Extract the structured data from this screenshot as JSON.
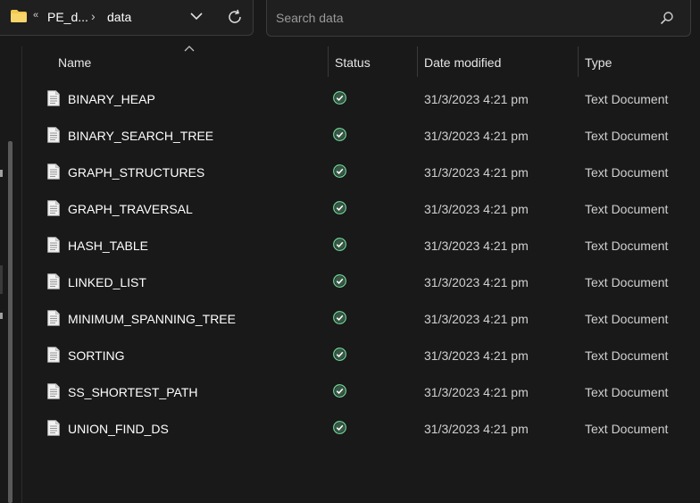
{
  "address_bar": {
    "overflow_glyph": "«",
    "parent_crumb": "PE_d...",
    "separator": "›",
    "current_crumb": "data",
    "folder_icon": "folder-icon",
    "dropdown_icon": "chevron-down-icon",
    "refresh_icon": "refresh-icon"
  },
  "search": {
    "placeholder": "Search data",
    "icon": "search-icon"
  },
  "columns": {
    "name": "Name",
    "status": "Status",
    "date_modified": "Date modified",
    "type": "Type"
  },
  "files": [
    {
      "name": "BINARY_HEAP",
      "status": "synced",
      "date": "31/3/2023 4:21 pm",
      "type": "Text Document"
    },
    {
      "name": "BINARY_SEARCH_TREE",
      "status": "synced",
      "date": "31/3/2023 4:21 pm",
      "type": "Text Document"
    },
    {
      "name": "GRAPH_STRUCTURES",
      "status": "synced",
      "date": "31/3/2023 4:21 pm",
      "type": "Text Document"
    },
    {
      "name": "GRAPH_TRAVERSAL",
      "status": "synced",
      "date": "31/3/2023 4:21 pm",
      "type": "Text Document"
    },
    {
      "name": "HASH_TABLE",
      "status": "synced",
      "date": "31/3/2023 4:21 pm",
      "type": "Text Document"
    },
    {
      "name": "LINKED_LIST",
      "status": "synced",
      "date": "31/3/2023 4:21 pm",
      "type": "Text Document"
    },
    {
      "name": "MINIMUM_SPANNING_TREE",
      "status": "synced",
      "date": "31/3/2023 4:21 pm",
      "type": "Text Document"
    },
    {
      "name": "SORTING",
      "status": "synced",
      "date": "31/3/2023 4:21 pm",
      "type": "Text Document"
    },
    {
      "name": "SS_SHORTEST_PATH",
      "status": "synced",
      "date": "31/3/2023 4:21 pm",
      "type": "Text Document"
    },
    {
      "name": "UNION_FIND_DS",
      "status": "synced",
      "date": "31/3/2023 4:21 pm",
      "type": "Text Document"
    }
  ],
  "colors": {
    "background": "#191919",
    "folder": "#f2c94c",
    "status_ok": "#6fcf97"
  }
}
